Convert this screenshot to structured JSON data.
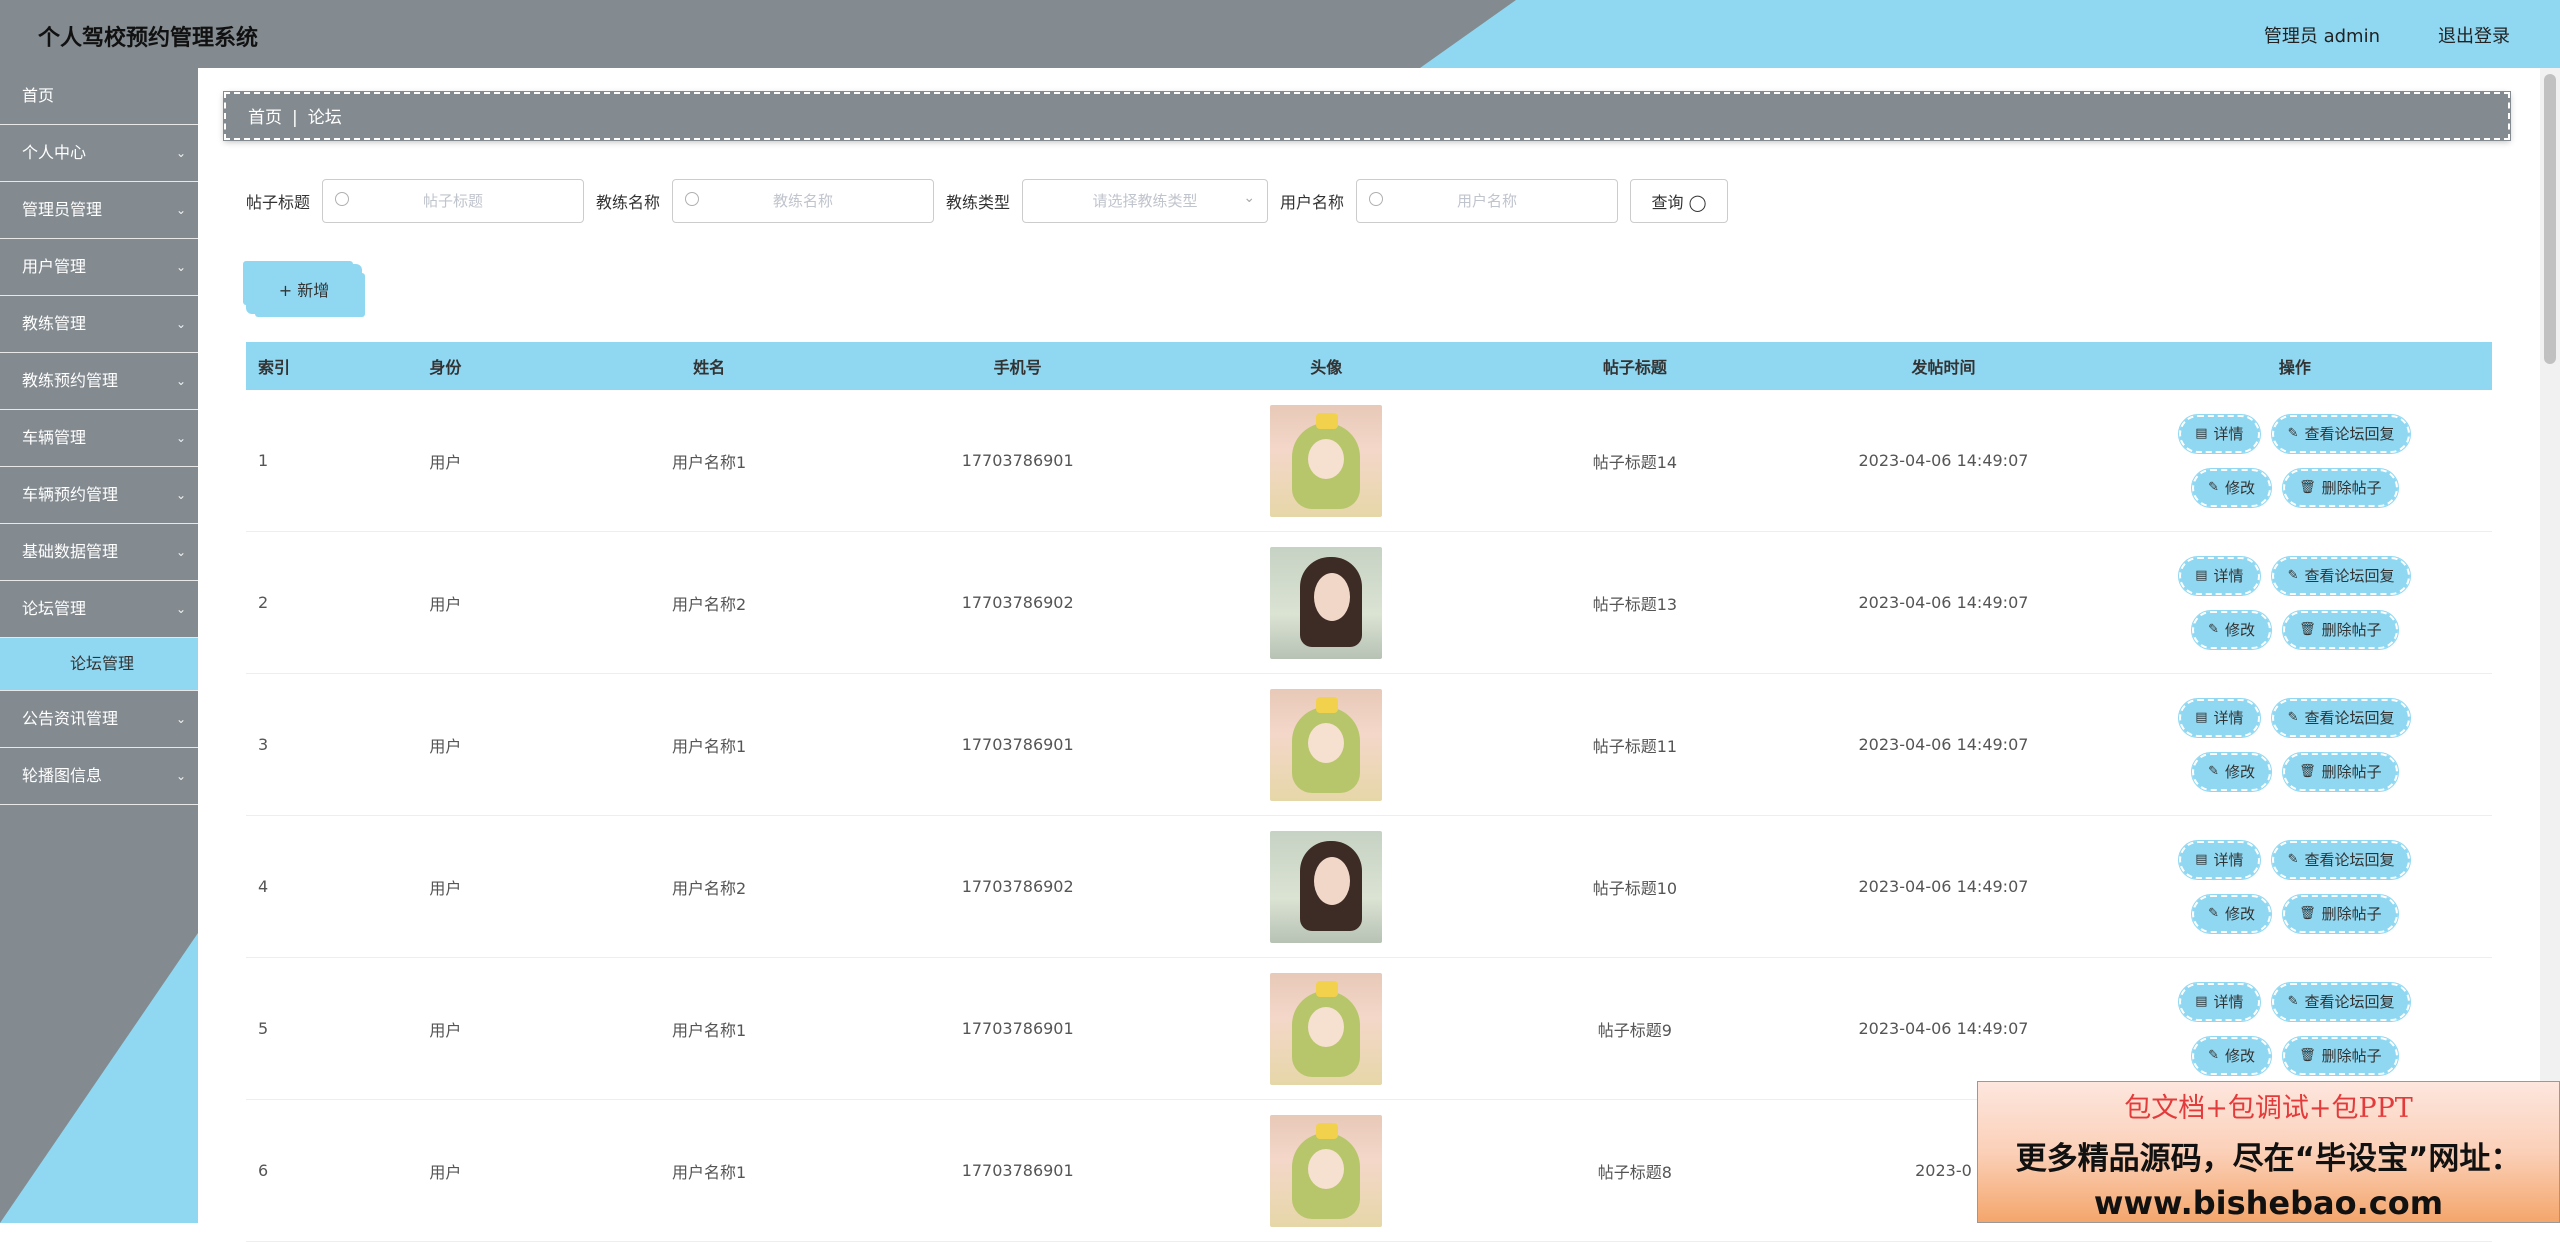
{
  "header": {
    "title": "个人驾校预约管理系统",
    "user_label": "管理员 admin",
    "logout_label": "退出登录"
  },
  "sidebar": {
    "items": [
      {
        "label": "首页",
        "has_arrow": false
      },
      {
        "label": "个人中心",
        "has_arrow": true
      },
      {
        "label": "管理员管理",
        "has_arrow": true
      },
      {
        "label": "用户管理",
        "has_arrow": true
      },
      {
        "label": "教练管理",
        "has_arrow": true
      },
      {
        "label": "教练预约管理",
        "has_arrow": true
      },
      {
        "label": "车辆管理",
        "has_arrow": true
      },
      {
        "label": "车辆预约管理",
        "has_arrow": true
      },
      {
        "label": "基础数据管理",
        "has_arrow": true
      },
      {
        "label": "论坛管理",
        "has_arrow": true,
        "expanded": true
      }
    ],
    "submenu_active": "论坛管理",
    "items_after": [
      {
        "label": "公告资讯管理",
        "has_arrow": true
      },
      {
        "label": "轮播图信息",
        "has_arrow": true
      }
    ]
  },
  "breadcrumb": {
    "home": "首页",
    "separator": "|",
    "current": "论坛"
  },
  "search": {
    "post_title_label": "帖子标题",
    "post_title_placeholder": "帖子标题",
    "coach_name_label": "教练名称",
    "coach_name_placeholder": "教练名称",
    "coach_type_label": "教练类型",
    "coach_type_placeholder": "请选择教练类型",
    "user_name_label": "用户名称",
    "user_name_placeholder": "用户名称",
    "query_label": "查询"
  },
  "toolbar": {
    "add_label": "新增"
  },
  "table": {
    "headers": [
      "索引",
      "身份",
      "姓名",
      "手机号",
      "头像",
      "帖子标题",
      "发帖时间",
      "操作"
    ],
    "actions": {
      "detail": "详情",
      "view_replies": "查看论坛回复",
      "edit": "修改",
      "delete": "删除帖子"
    },
    "rows": [
      {
        "index": "1",
        "identity": "用户",
        "name": "用户名称1",
        "phone": "17703786901",
        "avatar": "anime-girl",
        "title": "帖子标题14",
        "time": "2023-04-06 14:49:07"
      },
      {
        "index": "2",
        "identity": "用户",
        "name": "用户名称2",
        "phone": "17703786902",
        "avatar": "smiling-woman",
        "title": "帖子标题13",
        "time": "2023-04-06 14:49:07"
      },
      {
        "index": "3",
        "identity": "用户",
        "name": "用户名称1",
        "phone": "17703786901",
        "avatar": "anime-girl",
        "title": "帖子标题11",
        "time": "2023-04-06 14:49:07"
      },
      {
        "index": "4",
        "identity": "用户",
        "name": "用户名称2",
        "phone": "17703786902",
        "avatar": "smiling-woman",
        "title": "帖子标题10",
        "time": "2023-04-06 14:49:07"
      },
      {
        "index": "5",
        "identity": "用户",
        "name": "用户名称1",
        "phone": "17703786901",
        "avatar": "anime-girl",
        "title": "帖子标题9",
        "time": "2023-04-06 14:49:07"
      },
      {
        "index": "6",
        "identity": "用户",
        "name": "用户名称1",
        "phone": "17703786901",
        "avatar": "anime-girl",
        "title": "帖子标题8",
        "time": "2023-0"
      }
    ]
  },
  "promo": {
    "line1": "包文档+包调试+包PPT",
    "line2": "更多精品源码，尽在“毕设宝”网址：",
    "line3": "www.bishebao.com"
  },
  "colors": {
    "accent": "#90d8f2",
    "chrome": "#838b90"
  },
  "icons": [
    "search-icon",
    "chevron-down-icon",
    "plus-icon",
    "document-icon",
    "edit-icon",
    "trash-icon"
  ]
}
